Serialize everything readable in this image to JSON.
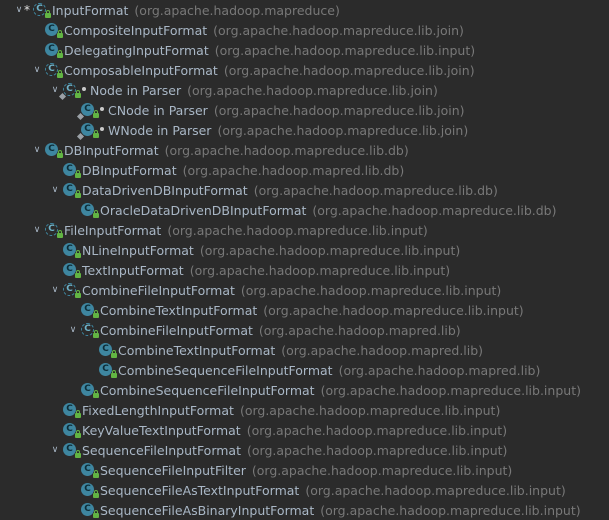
{
  "rows": [
    {
      "name": "InputFormat",
      "pkg": "(org.apache.hadoop.mapreduce)",
      "depth": 0,
      "caret": "expanded",
      "star": true,
      "kind": "abstract"
    },
    {
      "name": "CompositeInputFormat",
      "pkg": "(org.apache.hadoop.mapreduce.lib.join)",
      "depth": 1,
      "caret": "none",
      "kind": "class"
    },
    {
      "name": "DelegatingInputFormat",
      "pkg": "(org.apache.hadoop.mapreduce.lib.input)",
      "depth": 1,
      "caret": "none",
      "kind": "class"
    },
    {
      "name": "ComposableInputFormat",
      "pkg": "(org.apache.hadoop.mapreduce.lib.join)",
      "depth": 1,
      "caret": "expanded",
      "kind": "abstract"
    },
    {
      "name": "Node in Parser",
      "pkg": "(org.apache.hadoop.mapreduce.lib.join)",
      "depth": 2,
      "caret": "expanded",
      "kind": "abstract",
      "inner": true
    },
    {
      "name": "CNode in Parser",
      "pkg": "(org.apache.hadoop.mapreduce.lib.join)",
      "depth": 3,
      "caret": "none",
      "kind": "class",
      "inner": true
    },
    {
      "name": "WNode in Parser",
      "pkg": "(org.apache.hadoop.mapreduce.lib.join)",
      "depth": 3,
      "caret": "none",
      "kind": "class",
      "inner": true
    },
    {
      "name": "DBInputFormat",
      "pkg": "(org.apache.hadoop.mapreduce.lib.db)",
      "depth": 1,
      "caret": "expanded",
      "kind": "class"
    },
    {
      "name": "DBInputFormat",
      "pkg": "(org.apache.hadoop.mapred.lib.db)",
      "depth": 2,
      "caret": "none",
      "kind": "class"
    },
    {
      "name": "DataDrivenDBInputFormat",
      "pkg": "(org.apache.hadoop.mapreduce.lib.db)",
      "depth": 2,
      "caret": "expanded",
      "kind": "class"
    },
    {
      "name": "OracleDataDrivenDBInputFormat",
      "pkg": "(org.apache.hadoop.mapreduce.lib.db)",
      "depth": 3,
      "caret": "none",
      "kind": "class"
    },
    {
      "name": "FileInputFormat",
      "pkg": "(org.apache.hadoop.mapreduce.lib.input)",
      "depth": 1,
      "caret": "expanded",
      "kind": "abstract"
    },
    {
      "name": "NLineInputFormat",
      "pkg": "(org.apache.hadoop.mapreduce.lib.input)",
      "depth": 2,
      "caret": "none",
      "kind": "class"
    },
    {
      "name": "TextInputFormat",
      "pkg": "(org.apache.hadoop.mapreduce.lib.input)",
      "depth": 2,
      "caret": "none",
      "kind": "class"
    },
    {
      "name": "CombineFileInputFormat",
      "pkg": "(org.apache.hadoop.mapreduce.lib.input)",
      "depth": 2,
      "caret": "expanded",
      "kind": "abstract"
    },
    {
      "name": "CombineTextInputFormat",
      "pkg": "(org.apache.hadoop.mapreduce.lib.input)",
      "depth": 3,
      "caret": "none",
      "kind": "class"
    },
    {
      "name": "CombineFileInputFormat",
      "pkg": "(org.apache.hadoop.mapred.lib)",
      "depth": 3,
      "caret": "expanded",
      "kind": "abstract"
    },
    {
      "name": "CombineTextInputFormat",
      "pkg": "(org.apache.hadoop.mapred.lib)",
      "depth": 4,
      "caret": "none",
      "kind": "class"
    },
    {
      "name": "CombineSequenceFileInputFormat",
      "pkg": "(org.apache.hadoop.mapred.lib)",
      "depth": 4,
      "caret": "none",
      "kind": "class"
    },
    {
      "name": "CombineSequenceFileInputFormat",
      "pkg": "(org.apache.hadoop.mapreduce.lib.input)",
      "depth": 3,
      "caret": "none",
      "kind": "class"
    },
    {
      "name": "FixedLengthInputFormat",
      "pkg": "(org.apache.hadoop.mapreduce.lib.input)",
      "depth": 2,
      "caret": "none",
      "kind": "class"
    },
    {
      "name": "KeyValueTextInputFormat",
      "pkg": "(org.apache.hadoop.mapreduce.lib.input)",
      "depth": 2,
      "caret": "none",
      "kind": "class"
    },
    {
      "name": "SequenceFileInputFormat",
      "pkg": "(org.apache.hadoop.mapreduce.lib.input)",
      "depth": 2,
      "caret": "expanded",
      "kind": "class"
    },
    {
      "name": "SequenceFileInputFilter",
      "pkg": "(org.apache.hadoop.mapreduce.lib.input)",
      "depth": 3,
      "caret": "none",
      "kind": "class"
    },
    {
      "name": "SequenceFileAsTextInputFormat",
      "pkg": "(org.apache.hadoop.mapreduce.lib.input)",
      "depth": 3,
      "caret": "none",
      "kind": "class"
    },
    {
      "name": "SequenceFileAsBinaryInputFormat",
      "pkg": "(org.apache.hadoop.mapreduce.lib.input)",
      "depth": 3,
      "caret": "none",
      "kind": "class"
    }
  ],
  "icons": {
    "class": "class-icon",
    "abstract": "abstract-class-icon",
    "lock": "public-lock-icon",
    "caret_expanded": "chevron-down-icon"
  },
  "colors": {
    "background": "#2b2b2b",
    "name": "#a9b7c6",
    "package": "#787878",
    "class_icon": "#3e86a0",
    "access_lock": "#62b543"
  }
}
